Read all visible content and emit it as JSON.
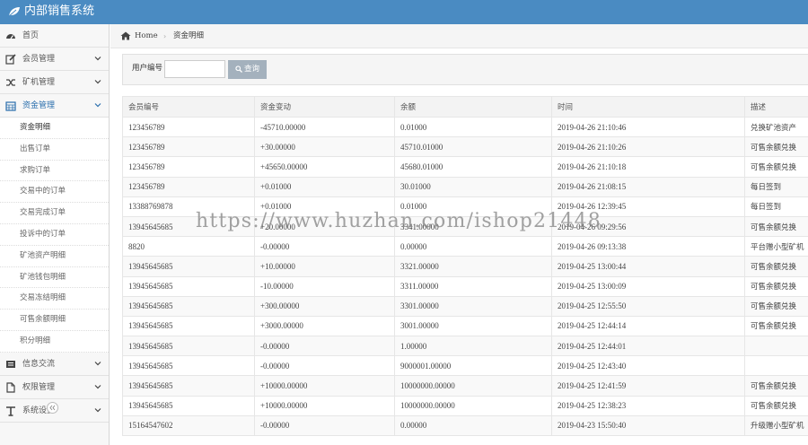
{
  "app": {
    "title": "内部销售系统"
  },
  "sidebar": {
    "items": [
      {
        "label": "首页",
        "icon": "dashboard-icon"
      },
      {
        "label": "会员管理",
        "icon": "edit-icon"
      },
      {
        "label": "矿机管理",
        "icon": "shuffle-icon"
      },
      {
        "label": "资金管理",
        "icon": "calendar-icon"
      }
    ],
    "submenu": [
      "资金明细",
      "出售订单",
      "求购订单",
      "交易中的订单",
      "交易完成订单",
      "投诉中的订单",
      "矿池资产明细",
      "矿池钱包明细",
      "交易冻结明细",
      "可售余额明细",
      "积分明细"
    ],
    "items_after": [
      {
        "label": "信息交流",
        "icon": "list-icon"
      },
      {
        "label": "权限管理",
        "icon": "file-icon"
      },
      {
        "label": "系统设置",
        "icon": "text-icon"
      }
    ],
    "collapse_icon": "«"
  },
  "breadcrumb": {
    "home": "Home",
    "separator": "›",
    "current": "资金明细"
  },
  "filter": {
    "label": "用户编号",
    "input_value": "",
    "button": "查询"
  },
  "table": {
    "headers": [
      "会员编号",
      "资金变动",
      "余额",
      "时间",
      "描述"
    ],
    "rows": [
      [
        "123456789",
        "-45710.00000",
        "0.01000",
        "2019-04-26 21:10:46",
        "兑换矿池资产"
      ],
      [
        "123456789",
        "+30.00000",
        "45710.01000",
        "2019-04-26 21:10:26",
        "可售余额兑换"
      ],
      [
        "123456789",
        "+45650.00000",
        "45680.01000",
        "2019-04-26 21:10:18",
        "可售余额兑换"
      ],
      [
        "123456789",
        "+0.01000",
        "30.01000",
        "2019-04-26 21:08:15",
        "每日签到"
      ],
      [
        "13388769878",
        "+0.01000",
        "0.01000",
        "2019-04-26 12:39:45",
        "每日签到"
      ],
      [
        "13945645685",
        "+20.00000",
        "3341.00000",
        "2019-04-26 09:29:56",
        "可售余额兑换"
      ],
      [
        "8820",
        "-0.00000",
        "0.00000",
        "2019-04-26 09:13:38",
        "平台赠小型矿机"
      ],
      [
        "13945645685",
        "+10.00000",
        "3321.00000",
        "2019-04-25 13:00:44",
        "可售余额兑换"
      ],
      [
        "13945645685",
        "-10.00000",
        "3311.00000",
        "2019-04-25 13:00:09",
        "可售余额兑换"
      ],
      [
        "13945645685",
        "+300.00000",
        "3301.00000",
        "2019-04-25 12:55:50",
        "可售余额兑换"
      ],
      [
        "13945645685",
        "+3000.00000",
        "3001.00000",
        "2019-04-25 12:44:14",
        "可售余额兑换"
      ],
      [
        "13945645685",
        "-0.00000",
        "1.00000",
        "2019-04-25 12:44:01",
        ""
      ],
      [
        "13945645685",
        "-0.00000",
        "9000001.00000",
        "2019-04-25 12:43:40",
        ""
      ],
      [
        "13945645685",
        "+10000.00000",
        "10000000.00000",
        "2019-04-25 12:41:59",
        "可售余额兑换"
      ],
      [
        "13945645685",
        "+10000.00000",
        "10000000.00000",
        "2019-04-25 12:38:23",
        "可售余额兑换"
      ],
      [
        "15164547602",
        "-0.00000",
        "0.00000",
        "2019-04-23 15:50:40",
        "升级赠小型矿机"
      ]
    ]
  },
  "watermark": "https://www.huzhan.com/ishop21448"
}
